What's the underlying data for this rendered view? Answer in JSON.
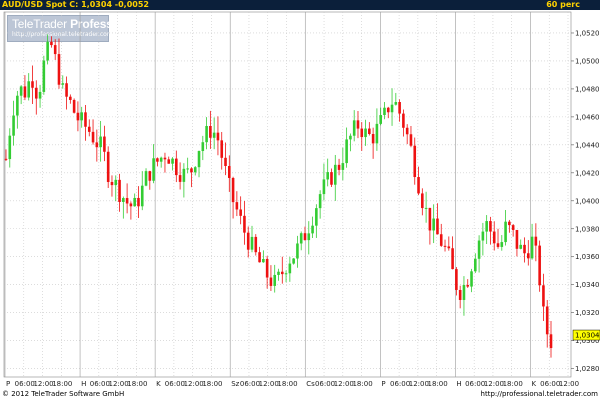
{
  "header": {
    "left_text": "AUD/USD Spot C: 1,0304 -0,0052",
    "right_text": "60 perc"
  },
  "logo": {
    "brand": "TeleTrader",
    "brand_bold": "Professional",
    "url": "http://professional.teletrader.com"
  },
  "footer": {
    "copyright": "© 2012 TeleTrader Software GmbH",
    "url": "http://professional.teletrader.com"
  },
  "colors": {
    "up": "#33cc33",
    "down": "#ee1111",
    "grid": "#c8c8c8",
    "last_price_bg": "#ffff00",
    "header_bg": "#0b1f3a",
    "header_text": "#ffd200"
  },
  "chart_data": {
    "type": "candlestick",
    "title": "AUD/USD Spot",
    "last_price": "1,0304",
    "interval": "60 perc",
    "y_ticks": [
      "1,0280",
      "1,0300",
      "1,0320",
      "1,0340",
      "1,0360",
      "1,0380",
      "1,0400",
      "1,0420",
      "1,0440",
      "1,0460",
      "1,0480",
      "1,0500",
      "1,0520"
    ],
    "ylim": [
      1.0274,
      1.0535
    ],
    "x_ticks": [
      "P",
      "06:00",
      "12:00",
      "18:00",
      "H",
      "06:00",
      "12:00",
      "18:00",
      "K",
      "06:00",
      "12:00",
      "18:00",
      "Sz",
      "06:00",
      "12:00",
      "18:00",
      "Cs",
      "06:00",
      "12:00",
      "18:00",
      "P",
      "06:00",
      "12:00",
      "18:00",
      "H",
      "06:00",
      "12:00",
      "18:00",
      "K",
      "06:00",
      "12:00"
    ],
    "grid": true,
    "series": [
      {
        "name": "AUD/USD Spot",
        "close_path": [
          1.043,
          1.0465,
          1.048,
          1.0478,
          1.049,
          1.0475,
          1.05,
          1.0512,
          1.0495,
          1.0475,
          1.047,
          1.046,
          1.0455,
          1.045,
          1.0443,
          1.0437,
          1.042,
          1.0412,
          1.0405,
          1.0398,
          1.0395,
          1.0405,
          1.0418,
          1.0425,
          1.043,
          1.0435,
          1.0428,
          1.0422,
          1.0418,
          1.0423,
          1.0438,
          1.0445,
          1.0452,
          1.0445,
          1.0425,
          1.0405,
          1.0393,
          1.038,
          1.037,
          1.036,
          1.0352,
          1.0345,
          1.034,
          1.0348,
          1.0358,
          1.0362,
          1.037,
          1.038,
          1.0392,
          1.0405,
          1.0412,
          1.042,
          1.0426,
          1.0438,
          1.0448,
          1.0455,
          1.0448,
          1.0445,
          1.0452,
          1.046,
          1.0472,
          1.0468,
          1.0455,
          1.044,
          1.042,
          1.04,
          1.0385,
          1.0377,
          1.037,
          1.036,
          1.0342,
          1.0335,
          1.0345,
          1.0362,
          1.0376,
          1.0383,
          1.0375,
          1.0365,
          1.0382,
          1.0376,
          1.0366,
          1.0362,
          1.0372,
          1.0354,
          1.031,
          1.03
        ]
      }
    ]
  }
}
